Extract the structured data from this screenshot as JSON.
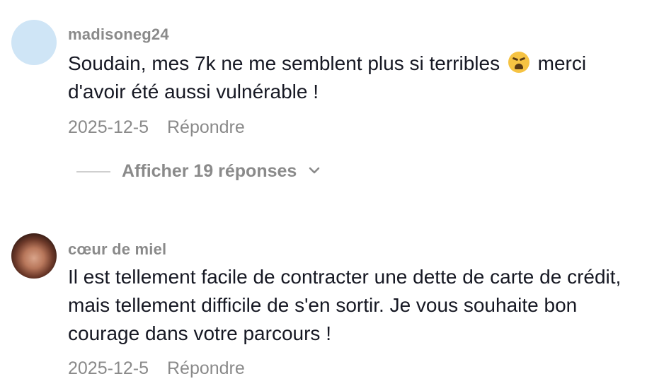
{
  "comments": [
    {
      "username": "madisoneg24",
      "text_before_emoji": "Soudain, mes 7k ne me semblent plus si terribles",
      "emoji": "weary-face",
      "text_after_emoji": "merci d'avoir été aussi vulnérable !",
      "date": "2025-12-5",
      "reply_label": "Répondre",
      "replies_toggle_label": "Afficher 19 réponses"
    },
    {
      "username": "cœur de miel",
      "text": "Il est tellement facile de contracter une dette de carte de crédit, mais tellement difficile de s'en sortir. Je vous souhaite bon courage dans votre parcours !",
      "date": "2025-12-5",
      "reply_label": "Répondre"
    }
  ],
  "colors": {
    "primary_text": "#161823",
    "secondary_text": "#8a8a8a",
    "avatar_placeholder": "#cfe5f6"
  }
}
